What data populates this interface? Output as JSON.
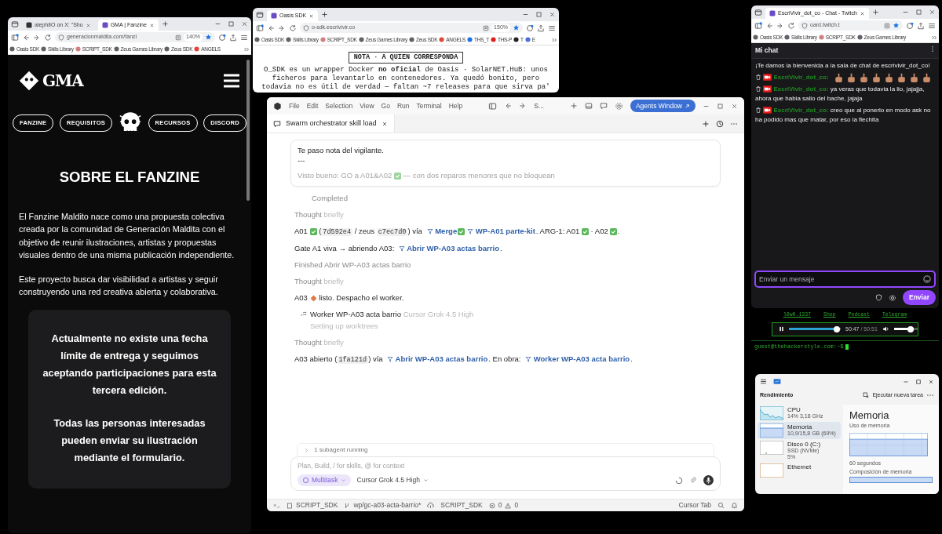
{
  "fanzine_browser": {
    "tabs": [
      {
        "label": "alephIIO on X: \"Shu",
        "selected": false
      },
      {
        "label": "GMA | Fanzine",
        "selected": true
      }
    ],
    "url": "generacionmaldita.com/fanzi",
    "zoom": "140%",
    "bookmarks": [
      {
        "label": "Oasis SDK",
        "color": "#5f6368"
      },
      {
        "label": "Skills Library",
        "color": "#5f6368"
      },
      {
        "label": "SCRIPT_SDK",
        "color": "#d08080"
      },
      {
        "label": "Zeus Games Library",
        "color": "#5f6368"
      },
      {
        "label": "Zeus SDK",
        "color": "#5f6368"
      },
      {
        "label": "ANGELS",
        "color": "#e0463c"
      }
    ],
    "page": {
      "logo_text": "GMA",
      "nav": [
        {
          "kind": "link",
          "label": "FANZINE"
        },
        {
          "kind": "link",
          "label": "REQUISITOS"
        },
        {
          "kind": "emblem"
        },
        {
          "kind": "link",
          "label": "RECURSOS"
        },
        {
          "kind": "link",
          "label": "DISCORD"
        }
      ],
      "heading": "SOBRE EL FANZINE",
      "paragraphs": [
        "El Fanzine Maldito nace como una propuesta colectiva creada por la comunidad de Generación Maldita con el objetivo de reunir ilustraciones, artistas y propuestas visuales dentro de una misma publicación independiente.",
        "Este proyecto busca dar visibilidad a artistas y seguir construyendo una red creativa abierta y colaborativa."
      ],
      "card": [
        "Actualmente no existe una fecha límite de entrega y seguimos aceptando participaciones para esta tercera edición.",
        "Todas las personas interesadas pueden enviar su ilustración mediante el formulario."
      ]
    }
  },
  "oasis_browser": {
    "tabs": [
      {
        "label": "Oasis SDK",
        "selected": true
      }
    ],
    "url": "o-sdk.escrivivir.co",
    "zoom": "150%",
    "bookmarks": [
      {
        "label": "Oasis SDK",
        "color": "#5f6368"
      },
      {
        "label": "Skills Library",
        "color": "#5f6368"
      },
      {
        "label": "SCRIPT_SDK",
        "color": "#d08080"
      },
      {
        "label": "Zeus Games Library",
        "color": "#5f6368"
      },
      {
        "label": "Zeus SDK",
        "color": "#5f6368"
      },
      {
        "label": "ANGELS",
        "color": "#e0463c"
      },
      {
        "label": "THS_T",
        "color": "#1a73e8"
      },
      {
        "label": "THS-P",
        "color": "#e02020"
      },
      {
        "label": "T",
        "color": "#222222"
      },
      {
        "label": "E",
        "color": "#4a6ee0"
      }
    ],
    "page": {
      "title": "NOTA · A QUIEN CORRESPONDA",
      "before": "O_SDK es un wrapper Docker **no oficial** de",
      "link": "Oasis · SolarNET.HuB",
      "after": ": unos ficheros para levantarlo en contenedores. Ya quedó bonito, pero todavia no es útil de verdad — faltan ~7 releases para que sirva pa'"
    }
  },
  "editor": {
    "menu": [
      "File",
      "Edit",
      "Selection",
      "View",
      "Go",
      "Run",
      "Terminal",
      "Help"
    ],
    "title": "S...",
    "agents_button": "Agents Window",
    "tab": "Swarm orchestrator skill load",
    "quote": {
      "lines": [
        "Te paso nota del vigilante.",
        "---"
      ],
      "faded": [
        {
          "kind": "text",
          "text": "Visto bueno: GO a A01&A02 "
        },
        {
          "kind": "check"
        },
        {
          "kind": "text",
          "text": " — con dos reparos menores que no bloquean"
        }
      ]
    },
    "entries": [
      {
        "kind": "status",
        "text": "Completed"
      },
      {
        "kind": "thought",
        "label": "Thought",
        "detail": "briefly"
      },
      {
        "kind": "message",
        "parts": [
          {
            "kind": "text",
            "text": "A01 "
          },
          {
            "kind": "check"
          },
          {
            "kind": "text",
            "text": " ("
          },
          {
            "kind": "code",
            "text": "7d592e4"
          },
          {
            "kind": "text",
            "text": " / zeus "
          },
          {
            "kind": "code",
            "text": "c7ec7d0"
          },
          {
            "kind": "text",
            "text": ") vía "
          },
          {
            "kind": "link",
            "text": "Merge"
          },
          {
            "kind": "check"
          },
          {
            "kind": "link",
            "text": "WP-A01 parte-kit"
          },
          {
            "kind": "text",
            "text": ". ARG-1: A01 "
          },
          {
            "kind": "check"
          },
          {
            "kind": "text",
            "text": " · A02 "
          },
          {
            "kind": "check"
          },
          {
            "kind": "text",
            "text": "."
          }
        ]
      },
      {
        "kind": "message",
        "parts": [
          {
            "kind": "text",
            "text": "Gate A1 viva → abriendo A03: "
          },
          {
            "kind": "link",
            "text": "Abrir WP-A03 actas barrio"
          },
          {
            "kind": "text",
            "text": "."
          }
        ]
      },
      {
        "kind": "finished",
        "text": "Finished Abrir WP-A03 actas barrio"
      },
      {
        "kind": "thought",
        "label": "Thought",
        "detail": "briefly"
      },
      {
        "kind": "message",
        "parts": [
          {
            "kind": "text",
            "text": "A03 "
          },
          {
            "kind": "diamond"
          },
          {
            "kind": "text",
            "text": " listo. Despacho el worker."
          }
        ]
      },
      {
        "kind": "worker",
        "name": "Worker WP-A03 acta barrio",
        "model": "Cursor Grok 4.5 High",
        "status": "Setting up worktrees"
      },
      {
        "kind": "thought",
        "label": "Thought",
        "detail": "briefly"
      },
      {
        "kind": "message",
        "parts": [
          {
            "kind": "text",
            "text": "A03 abierto ("
          },
          {
            "kind": "code",
            "text": "1fa121d"
          },
          {
            "kind": "text",
            "text": ") vía "
          },
          {
            "kind": "link",
            "text": "Abrir WP-A03 actas barrio"
          },
          {
            "kind": "text",
            "text": ". En obra: "
          },
          {
            "kind": "link",
            "text": "Worker WP-A03 acta barrio"
          },
          {
            "kind": "text",
            "text": "."
          }
        ]
      }
    ],
    "subagents": "1 subagent running",
    "input": {
      "placeholder": "Plan, Build, / for skills, @ for context",
      "mode": "Multitask",
      "model": "Cursor Grok 4.5 High"
    },
    "status": {
      "repo": "SCRIPT_SDK",
      "branch": "wp/gc-a03-acta-barrio*",
      "workspace": "SCRIPT_SDK",
      "errors": "0",
      "warnings": "0",
      "right": "Cursor Tab"
    }
  },
  "twitch_browser": {
    "tabs": [
      {
        "label": "EscriVivir_dot_co - Chat - Twitch",
        "selected": true
      }
    ],
    "url": "oard.twitch.t",
    "bookmarks": [
      {
        "label": "Oasis SDK",
        "color": "#5f6368"
      },
      {
        "label": "Skills Library",
        "color": "#5f6368"
      },
      {
        "label": "SCRIPT_SDK",
        "color": "#d08080"
      },
      {
        "label": "Zeus Games Library",
        "color": "#5f6368"
      }
    ],
    "chat": {
      "header": "Mi chat",
      "welcome": "¡Te damos la bienvenida a la sala de chat de escrivivir_dot_co!",
      "messages": [
        {
          "user": "EscriVivir_dot_co:",
          "emotes": [
            {
              "kind": "emote"
            },
            {
              "kind": "emote"
            },
            {
              "kind": "emote"
            },
            {
              "kind": "emote"
            },
            {
              "kind": "emote"
            },
            {
              "kind": "emote"
            },
            {
              "kind": "emote"
            },
            {
              "kind": "emote"
            }
          ]
        },
        {
          "user": "EscriVivir_dot_co:",
          "text": "ya veras que todavia la lio, jajajja, ahora que habia salio del bache, jajaja"
        },
        {
          "user": "EscriVivir_dot_co:",
          "text": "creo que al ponerlo en modo ask no ha podido mas que matar, por eso la flechita"
        }
      ],
      "placeholder": "Enviar un mensaje",
      "send": "Enviar"
    }
  },
  "site_footer": {
    "links": [
      "l0w0.1337",
      "Shop",
      "Podcast",
      "Telegram"
    ],
    "player": {
      "progress": {
        "level": 0.98
      },
      "time": "50:47",
      "duration": "/ 50:51",
      "volume": {
        "level": 0.85
      }
    },
    "prompt": "guest@thehackerstyle.com:~$"
  },
  "task_manager": {
    "header": "Rendimiento",
    "action": "Ejecutar nueva tarea",
    "resources": [
      {
        "kind": "cpu",
        "name": "CPU",
        "details": [
          "14% 3,18 GHz"
        ],
        "selected": false
      },
      {
        "kind": "memory",
        "name": "Memoria",
        "details": [
          "10,9/15,8 GB (69%)"
        ],
        "selected": true
      },
      {
        "kind": "disk",
        "name": "Disco 0 (C:)",
        "details": [
          "SSD (NVMe)",
          "5%"
        ],
        "selected": false
      },
      {
        "kind": "network",
        "name": "Ethernet",
        "selected": false
      }
    ],
    "panel": {
      "title": "Memoria",
      "usage_label": "Uso de memoria",
      "time_label": "60 segundos",
      "composition_label": "Composición de memoria"
    }
  }
}
